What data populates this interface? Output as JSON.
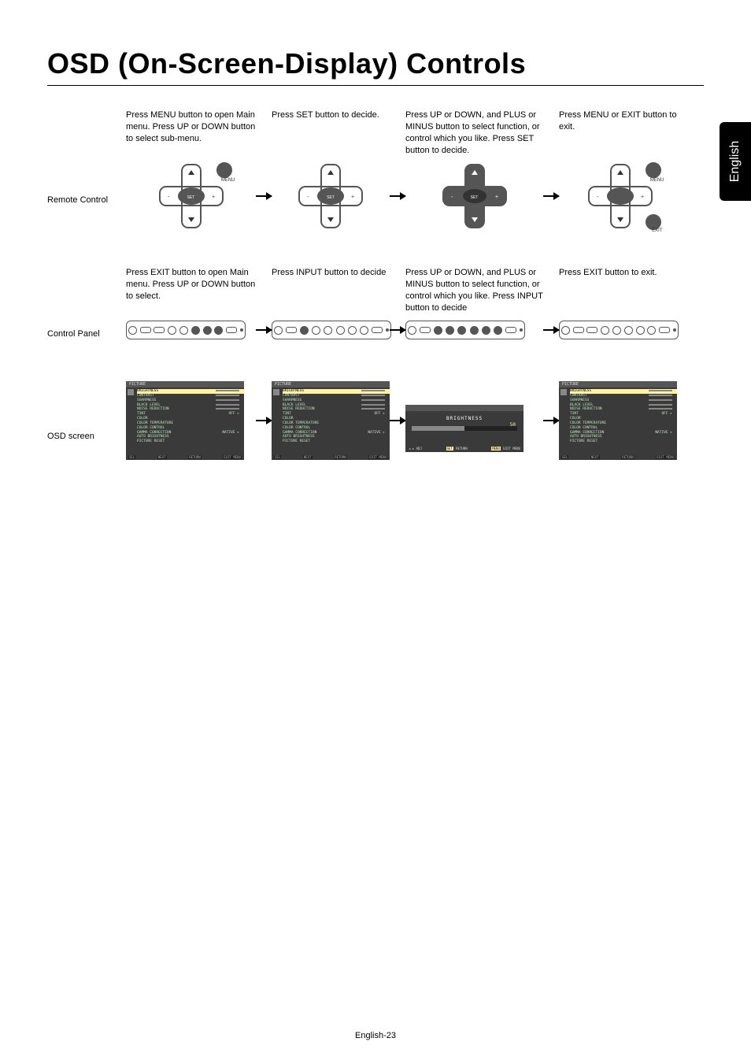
{
  "language_tab": "English",
  "page_title": "OSD (On-Screen-Display) Controls",
  "page_number": "English-23",
  "sections": {
    "remote": {
      "label": "Remote Control",
      "steps": [
        "Press MENU button to open Main menu.  Press UP or DOWN button to select sub-menu.",
        "Press SET button to decide.",
        "Press UP or DOWN, and PLUS or MINUS button to select  function, or control which you like. Press SET button to decide.",
        "Press MENU or EXIT button to exit."
      ],
      "btn_labels": {
        "menu": "MENU",
        "set": "SET",
        "exit": "EXIT"
      }
    },
    "panel": {
      "label": "Control Panel",
      "steps": [
        "Press EXIT button to open Main menu.  Press UP or DOWN button to select.",
        "Press INPUT button to decide",
        "Press UP or DOWN, and PLUS or MINUS button to select function, or control which you like.  Press INPUT button to decide",
        "Press EXIT button to exit."
      ]
    },
    "osd": {
      "label": "OSD screen",
      "menu_title": "PICTURE",
      "items": [
        {
          "name": "BRIGHTNESS"
        },
        {
          "name": "CONTRAST"
        },
        {
          "name": "SHARPNESS"
        },
        {
          "name": "BLACK LEVEL"
        },
        {
          "name": "NOISE REDUCTION"
        },
        {
          "name": "TINT",
          "value": "OFF"
        },
        {
          "name": "COLOR"
        },
        {
          "name": "COLOR TEMPERATURE"
        },
        {
          "name": "COLOR CONTROL"
        },
        {
          "name": "GAMMA CORRECTION",
          "value": "NATIVE"
        },
        {
          "name": "AUTO BRIGHTNESS"
        },
        {
          "name": "PICTURE RESET"
        }
      ],
      "footer": {
        "sel": "SEL",
        "next": "NEXT",
        "return": "RETURN",
        "exit": "EXIT MENU"
      },
      "adjust": {
        "title": "BRIGHTNESS",
        "value": "50",
        "adj": "ADJ",
        "return_btn": "SET",
        "return_lbl": "RETURN",
        "exit_btn": "MENU",
        "exit_lbl": "EXIT MENU"
      }
    }
  }
}
